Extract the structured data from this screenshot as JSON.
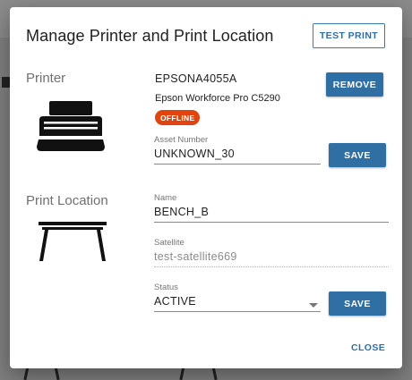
{
  "dialog": {
    "title": "Manage Printer and Print Location",
    "test_print_label": "TEST PRINT",
    "close_label": "CLOSE"
  },
  "printer": {
    "section_label": "Printer",
    "id": "EPSONA4055A",
    "model": "Epson Workforce Pro C5290",
    "status_badge": "OFFLINE",
    "remove_label": "REMOVE",
    "asset_number": {
      "label": "Asset Number",
      "value": "UNKNOWN_30"
    },
    "save_label": "SAVE",
    "icon": "printer-icon"
  },
  "print_location": {
    "section_label": "Print Location",
    "name": {
      "label": "Name",
      "value": "BENCH_B"
    },
    "satellite": {
      "label": "Satellite",
      "value": "test-satellite669"
    },
    "status": {
      "label": "Status",
      "value": "ACTIVE"
    },
    "save_label": "SAVE",
    "icon": "bench-table-icon"
  },
  "colors": {
    "primary": "#2f6fa4",
    "badge_offline": "#e0450f"
  }
}
